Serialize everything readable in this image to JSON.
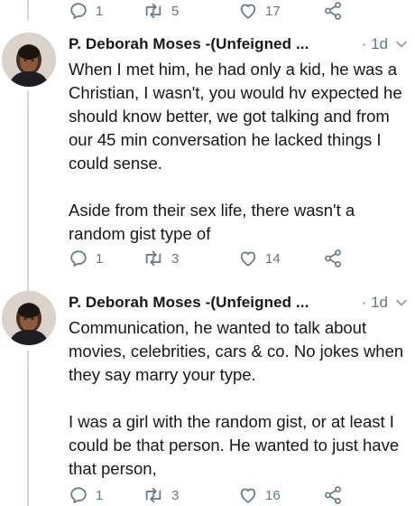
{
  "top_actions": {
    "reply_count": "1",
    "retweet_count": "5",
    "like_count": "17"
  },
  "tweets": [
    {
      "name": "P. Deborah Moses -(Unfeigned ...",
      "time": "· 1d",
      "text": "When I met him, he had only a kid, he was a Christian, I wasn't, you would hv expected he should know better, we got talking and from our 45 min conversation he lacked things I could sense.\n\nAside from their sex life, there wasn't a random gist type of",
      "reply_count": "1",
      "retweet_count": "3",
      "like_count": "14"
    },
    {
      "name": "P. Deborah Moses -(Unfeigned ...",
      "time": "· 1d",
      "text": "Communication, he wanted to talk about movies, celebrities, cars & co. No jokes when they say marry your type.\n\nI was a girl with the random gist, or at least I could be that person. He wanted to just have that person,",
      "reply_count": "1",
      "retweet_count": "3",
      "like_count": "16"
    }
  ],
  "icons": {
    "reply": "reply-icon",
    "retweet": "retweet-icon",
    "like": "heart-icon",
    "share": "share-icon",
    "caret": "chevron-down-icon"
  },
  "colors": {
    "text": "#14171a",
    "muted": "#657786",
    "thread_line": "#ccd6dd"
  }
}
